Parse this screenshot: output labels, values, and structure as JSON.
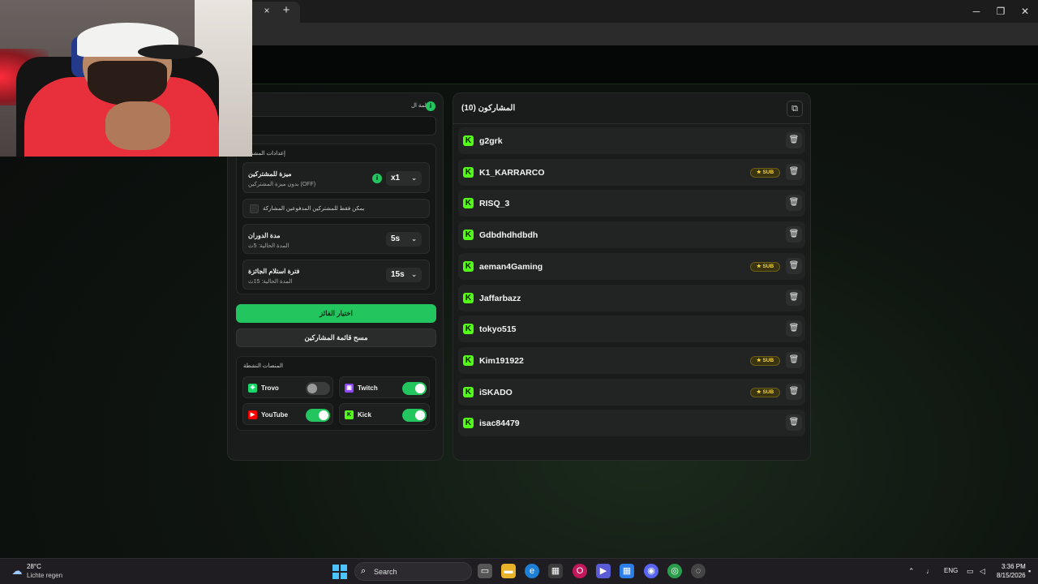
{
  "browser": {
    "tab_close": "×",
    "new_tab": "+",
    "minimize": "─",
    "maximize": "❐",
    "close": "✕"
  },
  "settings": {
    "keyword_label": "الكلمة ال",
    "participant_settings_label": "إعدادات المشت",
    "sub_advantage": {
      "title": "ميزة للمشتركين",
      "subtitle": "بدون ميزة المشتركين (OFF)",
      "value": "x1"
    },
    "subs_only_label": "يمكن فقط للمشتركين المدفوعين المشاركة",
    "spin_duration": {
      "title": "مدة الدوران",
      "subtitle": "المدة الحالية: 5ث",
      "value": "5s"
    },
    "claim_period": {
      "title": "فترة استلام الجائزة",
      "subtitle": "المدة الحالية: 15ث",
      "value": "15s"
    },
    "pick_winner_label": "اختيار الفائز",
    "clear_list_label": "مسح قائمة المشاركين",
    "active_platforms_label": "المنصات النشطة",
    "platforms": [
      {
        "name": "Trovo",
        "enabled": false,
        "color": "#19d66b"
      },
      {
        "name": "Twitch",
        "enabled": true,
        "color": "#9146ff"
      },
      {
        "name": "YouTube",
        "enabled": true,
        "color": "#ff0000"
      },
      {
        "name": "Kick",
        "enabled": true,
        "color": "#53fc18"
      }
    ]
  },
  "participants": {
    "title": "المشاركون (10)",
    "sub_badge": "★ SUB",
    "items": [
      {
        "name": "g2grk",
        "sub": false
      },
      {
        "name": "K1_KARRARCO",
        "sub": true
      },
      {
        "name": "RISQ_3",
        "sub": false
      },
      {
        "name": "Gdbdhdhdbdh",
        "sub": false
      },
      {
        "name": "aeman4Gaming",
        "sub": true
      },
      {
        "name": "Jaffarbazz",
        "sub": false
      },
      {
        "name": "tokyo515",
        "sub": false
      },
      {
        "name": "Kim191922",
        "sub": true
      },
      {
        "name": "iSKADO",
        "sub": true
      },
      {
        "name": "isac84479",
        "sub": false
      }
    ]
  },
  "taskbar": {
    "temperature": "28°C",
    "weather": "Lichte regen",
    "search_placeholder": "Search",
    "language": "ENG",
    "time": "3:36 PM",
    "date": "8/15/2026"
  },
  "colors": {
    "accent": "#22c55e",
    "kick": "#53fc18",
    "sub_badge": "#f2d43b"
  }
}
